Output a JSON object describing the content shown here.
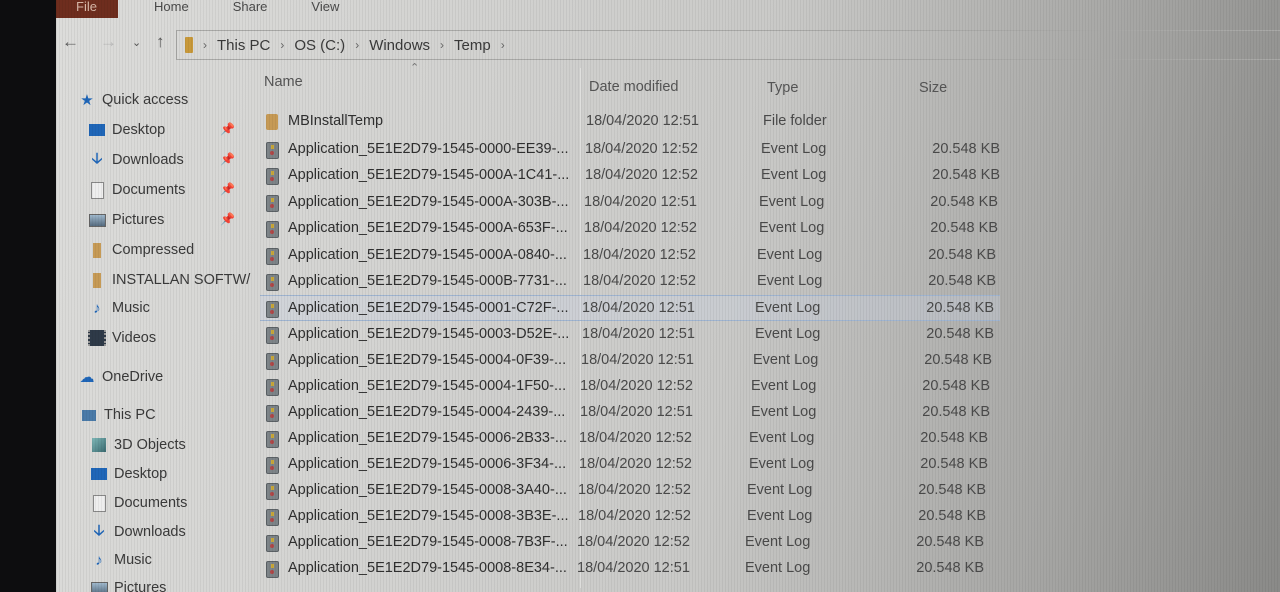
{
  "ribbon": {
    "tabs": [
      "File",
      "Home",
      "Share",
      "View"
    ]
  },
  "nav": {
    "back_icon": "arrow-left",
    "forward_icon": "arrow-right",
    "recent_icon": "chevron-down",
    "up_icon": "arrow-up",
    "breadcrumb": [
      "This PC",
      "OS (C:)",
      "Windows",
      "Temp"
    ]
  },
  "sidebar": {
    "items": [
      {
        "label": "Quick access",
        "icon": "star",
        "pinned": false
      },
      {
        "label": "Desktop",
        "icon": "desktop",
        "pinned": true
      },
      {
        "label": "Downloads",
        "icon": "download",
        "pinned": true
      },
      {
        "label": "Documents",
        "icon": "document",
        "pinned": true
      },
      {
        "label": "Pictures",
        "icon": "pictures",
        "pinned": true
      },
      {
        "label": "Compressed",
        "icon": "folder",
        "pinned": false
      },
      {
        "label": "INSTALLAN SOFTW/",
        "icon": "folder",
        "pinned": false
      },
      {
        "label": "Music",
        "icon": "music",
        "pinned": false
      },
      {
        "label": "Videos",
        "icon": "videos",
        "pinned": false
      },
      {
        "label": "OneDrive",
        "icon": "cloud",
        "pinned": false
      },
      {
        "label": "This PC",
        "icon": "computer",
        "pinned": false
      },
      {
        "label": "3D Objects",
        "icon": "cube",
        "pinned": false
      },
      {
        "label": "Desktop",
        "icon": "desktop",
        "pinned": false
      },
      {
        "label": "Documents",
        "icon": "document",
        "pinned": false
      },
      {
        "label": "Downloads",
        "icon": "download",
        "pinned": false
      },
      {
        "label": "Music",
        "icon": "music",
        "pinned": false
      },
      {
        "label": "Pictures",
        "icon": "pictures",
        "pinned": false
      }
    ]
  },
  "columns": {
    "name": "Name",
    "date": "Date modified",
    "type": "Type",
    "size": "Size"
  },
  "files": [
    {
      "name": "MBInstallTemp",
      "date": "18/04/2020 12:51",
      "type": "File folder",
      "size": "",
      "icon": "folder"
    },
    {
      "name": "Application_5E1E2D79-1545-0000-EE39-...",
      "date": "18/04/2020 12:52",
      "type": "Event Log",
      "size": "20.548 KB",
      "icon": "log"
    },
    {
      "name": "Application_5E1E2D79-1545-000A-1C41-...",
      "date": "18/04/2020 12:52",
      "type": "Event Log",
      "size": "20.548 KB",
      "icon": "log"
    },
    {
      "name": "Application_5E1E2D79-1545-000A-303B-...",
      "date": "18/04/2020 12:51",
      "type": "Event Log",
      "size": "20.548 KB",
      "icon": "log"
    },
    {
      "name": "Application_5E1E2D79-1545-000A-653F-...",
      "date": "18/04/2020 12:52",
      "type": "Event Log",
      "size": "20.548 KB",
      "icon": "log"
    },
    {
      "name": "Application_5E1E2D79-1545-000A-0840-...",
      "date": "18/04/2020 12:52",
      "type": "Event Log",
      "size": "20.548 KB",
      "icon": "log"
    },
    {
      "name": "Application_5E1E2D79-1545-000B-7731-...",
      "date": "18/04/2020 12:52",
      "type": "Event Log",
      "size": "20.548 KB",
      "icon": "log"
    },
    {
      "name": "Application_5E1E2D79-1545-0001-C72F-...",
      "date": "18/04/2020 12:51",
      "type": "Event Log",
      "size": "20.548 KB",
      "icon": "log",
      "selected": true
    },
    {
      "name": "Application_5E1E2D79-1545-0003-D52E-...",
      "date": "18/04/2020 12:51",
      "type": "Event Log",
      "size": "20.548 KB",
      "icon": "log"
    },
    {
      "name": "Application_5E1E2D79-1545-0004-0F39-...",
      "date": "18/04/2020 12:51",
      "type": "Event Log",
      "size": "20.548 KB",
      "icon": "log"
    },
    {
      "name": "Application_5E1E2D79-1545-0004-1F50-...",
      "date": "18/04/2020 12:52",
      "type": "Event Log",
      "size": "20.548 KB",
      "icon": "log"
    },
    {
      "name": "Application_5E1E2D79-1545-0004-2439-...",
      "date": "18/04/2020 12:51",
      "type": "Event Log",
      "size": "20.548 KB",
      "icon": "log"
    },
    {
      "name": "Application_5E1E2D79-1545-0006-2B33-...",
      "date": "18/04/2020 12:52",
      "type": "Event Log",
      "size": "20.548 KB",
      "icon": "log"
    },
    {
      "name": "Application_5E1E2D79-1545-0006-3F34-...",
      "date": "18/04/2020 12:52",
      "type": "Event Log",
      "size": "20.548 KB",
      "icon": "log"
    },
    {
      "name": "Application_5E1E2D79-1545-0008-3A40-...",
      "date": "18/04/2020 12:52",
      "type": "Event Log",
      "size": "20.548 KB",
      "icon": "log"
    },
    {
      "name": "Application_5E1E2D79-1545-0008-3B3E-...",
      "date": "18/04/2020 12:52",
      "type": "Event Log",
      "size": "20.548 KB",
      "icon": "log"
    },
    {
      "name": "Application_5E1E2D79-1545-0008-7B3F-...",
      "date": "18/04/2020 12:52",
      "type": "Event Log",
      "size": "20.548 KB",
      "icon": "log"
    },
    {
      "name": "Application_5E1E2D79-1545-0008-8E34-...",
      "date": "18/04/2020 12:51",
      "type": "Event Log",
      "size": "20.548 KB",
      "icon": "log"
    }
  ],
  "colors": {
    "file_tab": "#6e2d1e",
    "accent_blue": "#1f66b8",
    "folder": "#c69a55"
  }
}
